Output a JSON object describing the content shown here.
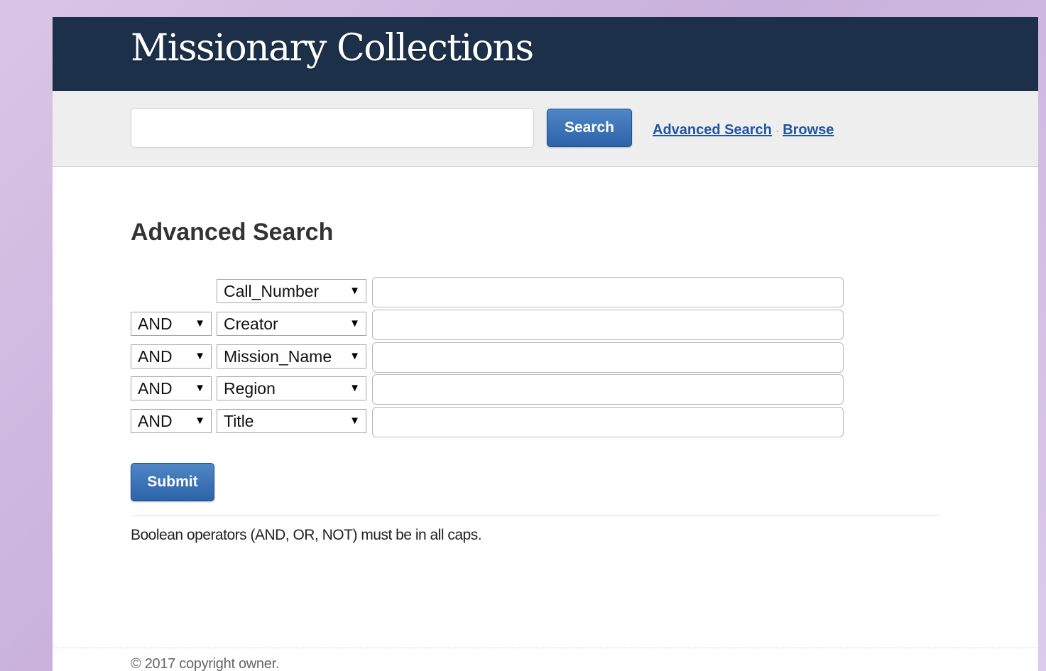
{
  "header": {
    "title": "Missionary Collections"
  },
  "search": {
    "value": "",
    "button_label": "Search"
  },
  "links": {
    "advanced": "Advanced Search",
    "separator": "·",
    "browse": "Browse"
  },
  "advanced": {
    "title": "Advanced Search",
    "dropdown_icon": "triangle-down",
    "rows": [
      {
        "operator": "",
        "field": "Call_Number",
        "value": ""
      },
      {
        "operator": "AND",
        "field": "Creator",
        "value": ""
      },
      {
        "operator": "AND",
        "field": "Mission_Name",
        "value": ""
      },
      {
        "operator": "AND",
        "field": "Region",
        "value": ""
      },
      {
        "operator": "AND",
        "field": "Title",
        "value": ""
      }
    ],
    "submit_label": "Submit",
    "help": "Boolean operators (AND, OR, NOT) must be in all caps."
  },
  "footer": {
    "copyright": "© 2017 copyright owner."
  },
  "colors": {
    "header_bg": "#1c3049",
    "button_blue": "#2d63a8",
    "link_blue": "#1f55a3",
    "search_bar_bg": "#eeeeee"
  }
}
